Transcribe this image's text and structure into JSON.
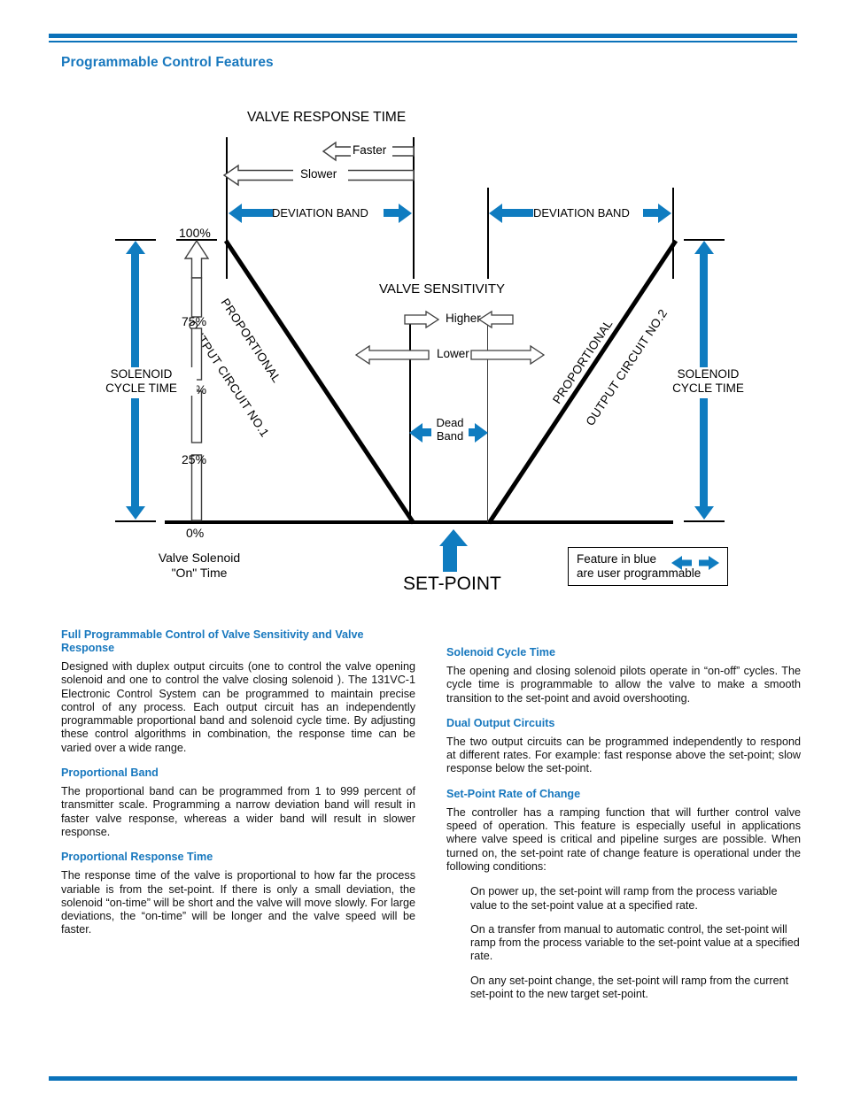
{
  "header": {
    "title": "Programmable Control Features",
    "accent_color": "#1878be",
    "rule_color": "#0b72ba"
  },
  "diagram": {
    "title_top": "VALVE RESPONSE TIME",
    "title_center": "VALVE SENSITIVITY",
    "response_faster": "Faster",
    "response_slower": "Slower",
    "deviation_band_left": "DEVIATION BAND",
    "deviation_band_right": "DEVIATION BAND",
    "sensitivity_higher": "Higher",
    "sensitivity_lower": "Lower",
    "dead_band_line1": "Dead",
    "dead_band_line2": "Band",
    "circuit_left_line1": "PROPORTIONAL",
    "circuit_left_line2": "OUTPUT CIRCUIT NO.1",
    "circuit_right_line1": "PROPORTIONAL",
    "circuit_right_line2": "OUTPUT CIRCUIT NO.2",
    "solenoid_left_line1": "SOLENOID",
    "solenoid_left_line2": "CYCLE TIME",
    "solenoid_right_line1": "SOLENOID",
    "solenoid_right_line2": "CYCLE TIME",
    "axis_caption_line1": "Valve Solenoid",
    "axis_caption_line2": "\"On\" Time",
    "setpoint_label": "SET-POINT",
    "legend_line1": "Feature in blue",
    "legend_line2": "are user programmable",
    "scale_ticks": [
      "100%",
      "75%",
      "50%",
      "25%",
      "0%"
    ],
    "blue_color": "#0f7cc0"
  },
  "content": {
    "left": [
      {
        "heading": "Full Programmable Control of Valve Sensitivity and Valve Response",
        "body": "Designed with duplex output circuits (one to control the valve opening solenoid and one to control the valve closing solenoid ). The 131VC-1 Electronic Control System can be programmed to maintain precise control of any process. Each output circuit  has an independently programmable proportional band and solenoid cycle time. By  adjusting these control algorithms in combination, the response time can be varied over a wide range."
      },
      {
        "heading": "Proportional Band",
        "body": "The proportional band can be programmed from 1 to 999 percent of transmitter scale. Programming a narrow deviation band will result in faster valve response, whereas a wider band will result in slower response."
      },
      {
        "heading": "Proportional Response Time",
        "body": "The response time of the valve is proportional to how far the process variable is from the set-point. If there is only a small deviation, the solenoid “on-time” will be short and the valve will move slowly. For large deviations, the “on-time” will be longer and the valve speed will be faster."
      }
    ],
    "right": [
      {
        "heading": "Solenoid Cycle Time",
        "body": "The opening and closing solenoid pilots operate in “on-off” cycles. The cycle time is programmable to allow the valve to make a smooth transition to the set-point and avoid overshooting."
      },
      {
        "heading": "Dual Output Circuits",
        "body": "The two output circuits can be programmed independently to respond at different rates. For example: fast response above the set-point; slow response below the set-point."
      },
      {
        "heading": "Set-Point Rate of Change",
        "body": "The controller has a ramping function that will further control valve speed of operation. This feature is especially useful in applications where valve speed is critical and pipeline surges are possible. When turned on, the set-point rate of change feature is operational under the following conditions:"
      }
    ],
    "right_bullets": [
      "On power up, the set-point will ramp from the process variable value to the set-point value at a specified rate.",
      "On a transfer from manual to automatic control, the set-point will ramp from the process variable to the set-point value at a specified rate.",
      "On any set-point change, the set-point will ramp from the current set-point to the new target set-point."
    ]
  }
}
